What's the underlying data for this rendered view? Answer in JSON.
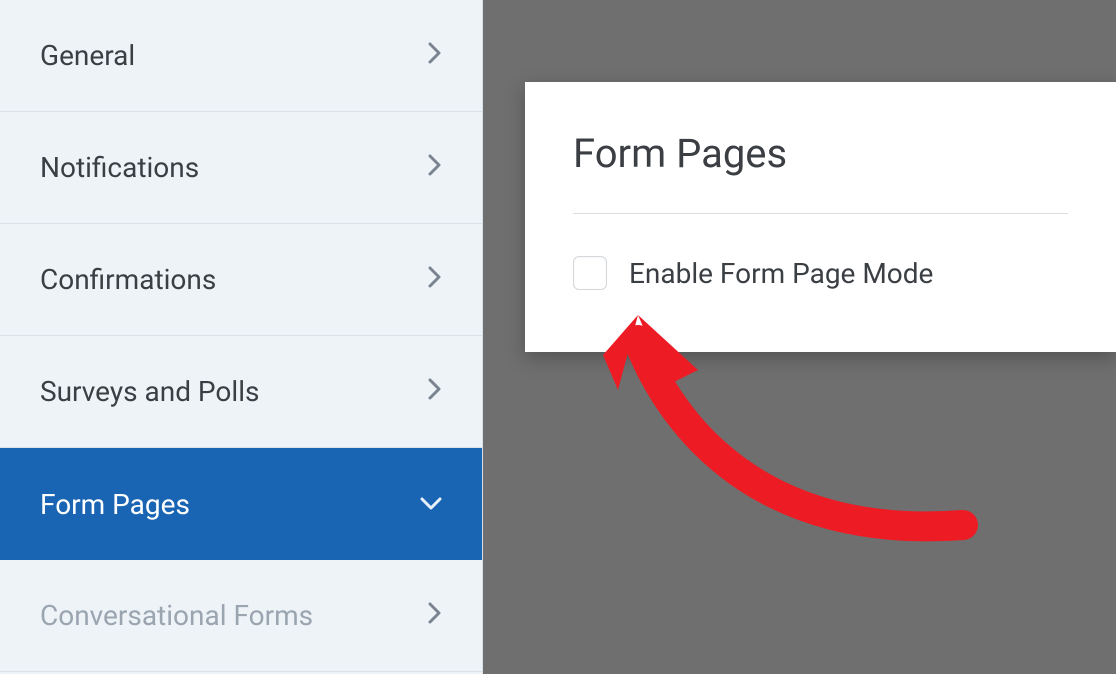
{
  "sidebar": {
    "items": [
      {
        "label": "General",
        "active": false,
        "disabled": false
      },
      {
        "label": "Notifications",
        "active": false,
        "disabled": false
      },
      {
        "label": "Confirmations",
        "active": false,
        "disabled": false
      },
      {
        "label": "Surveys and Polls",
        "active": false,
        "disabled": false
      },
      {
        "label": "Form Pages",
        "active": true,
        "disabled": false
      },
      {
        "label": "Conversational Forms",
        "active": false,
        "disabled": true
      }
    ]
  },
  "panel": {
    "title": "Form Pages",
    "option_label": "Enable Form Page Mode",
    "option_checked": false
  },
  "annotation": {
    "color": "#ed1c24"
  }
}
